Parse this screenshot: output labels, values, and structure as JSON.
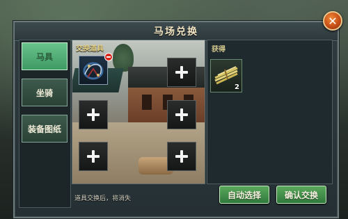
{
  "dialog": {
    "title": "马场兑换"
  },
  "tabs": [
    {
      "label": "马具",
      "active": true
    },
    {
      "label": "坐骑",
      "active": false
    },
    {
      "label": "装备图纸",
      "active": false
    }
  ],
  "exchange": {
    "label": "交换道具",
    "hint": "道具交换后，将消失"
  },
  "obtain": {
    "label": "获得",
    "reward_count": "2"
  },
  "buttons": {
    "auto_select": "自动选择",
    "confirm": "确认交换"
  },
  "colors": {
    "accent_green": "#3d9a62",
    "title_gold": "#f3e6c4",
    "close_orange": "#c24a14"
  }
}
